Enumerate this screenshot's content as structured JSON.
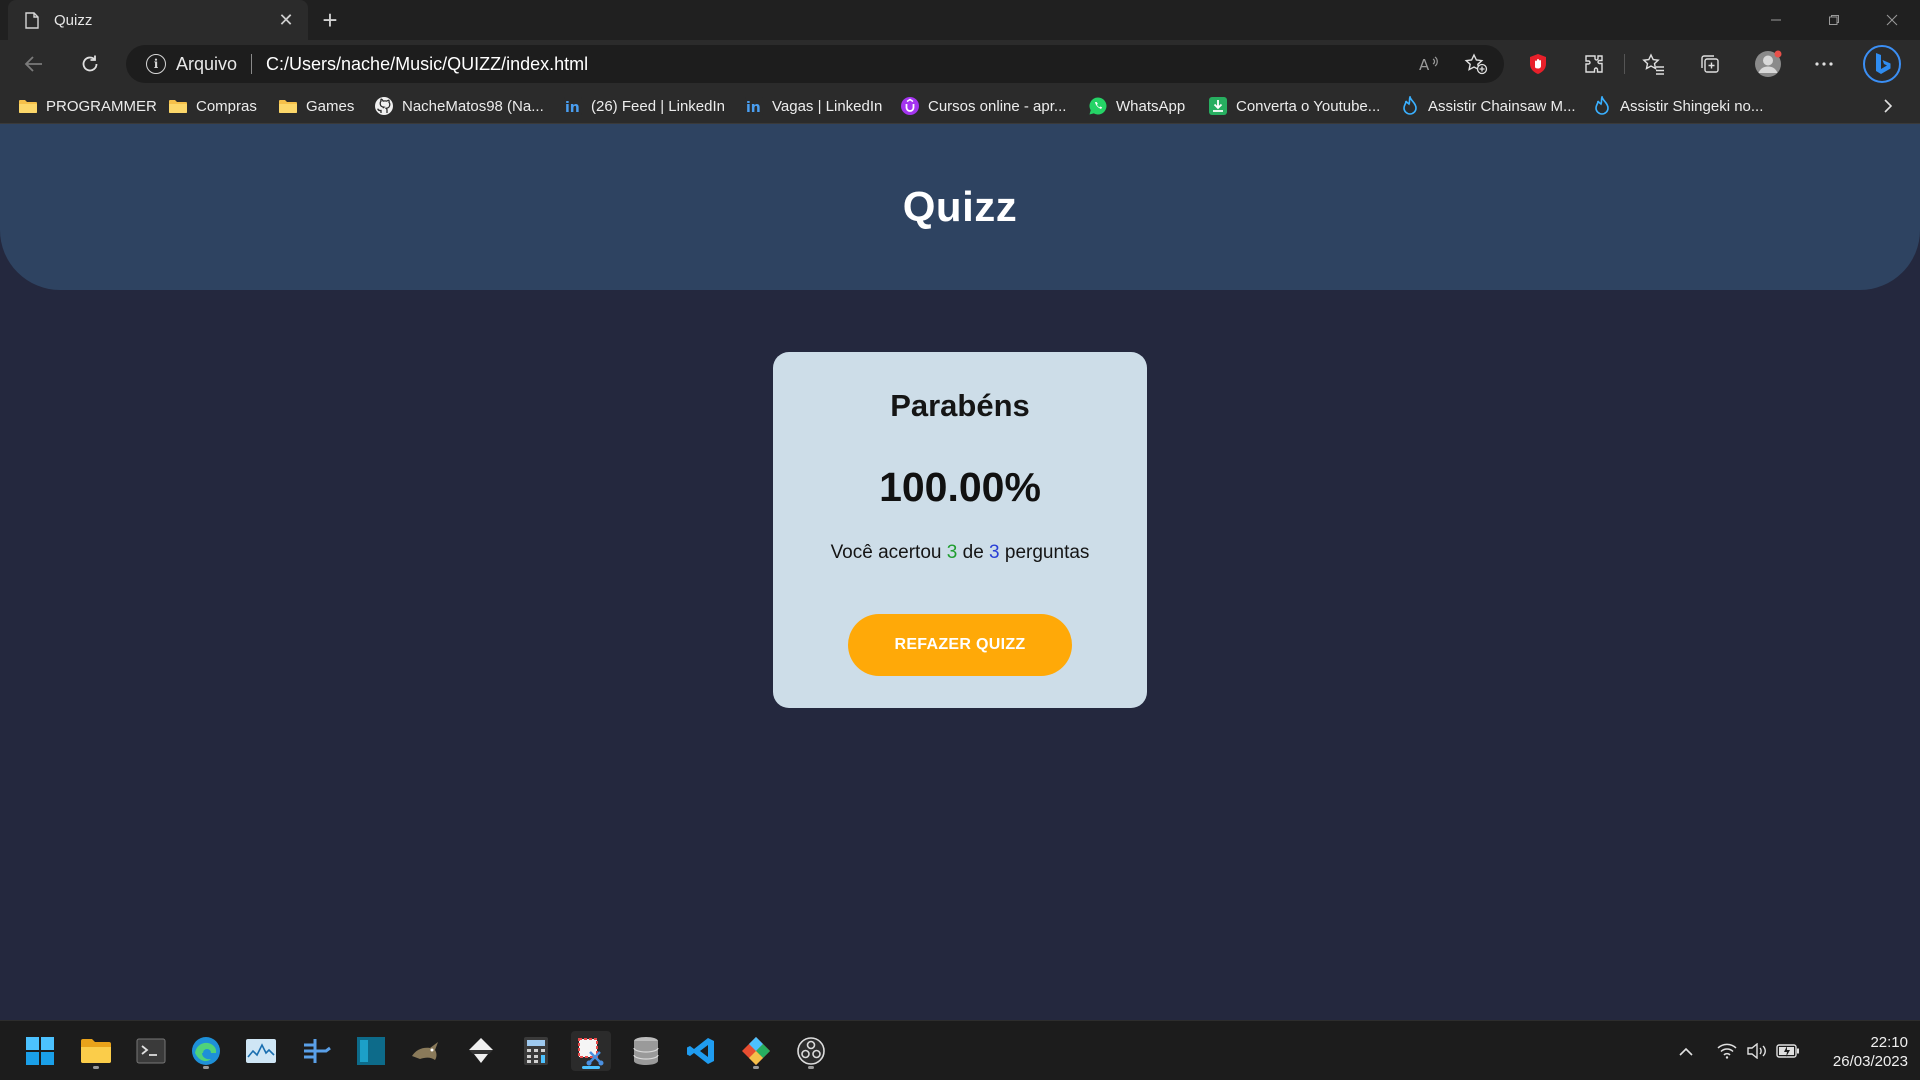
{
  "browser": {
    "tab": {
      "title": "Quizz",
      "close": "✕"
    },
    "new_tab": "+",
    "address": {
      "site_label": "Arquivo",
      "url": "C:/Users/nache/Music/QUIZZ/index.html"
    },
    "bookmarks": [
      {
        "label": "PROGRAMMER",
        "icon": "folder-icon"
      },
      {
        "label": "Compras",
        "icon": "folder-icon"
      },
      {
        "label": "Games",
        "icon": "folder-icon"
      },
      {
        "label": "NacheMatos98 (Na...",
        "icon": "github-icon"
      },
      {
        "label": "(26) Feed | LinkedIn",
        "icon": "linkedin-icon"
      },
      {
        "label": "Vagas | LinkedIn",
        "icon": "linkedin-icon"
      },
      {
        "label": "Cursos online - apr...",
        "icon": "udemy-icon"
      },
      {
        "label": "WhatsApp",
        "icon": "whatsapp-icon"
      },
      {
        "label": "Converta o Youtube...",
        "icon": "download-icon"
      },
      {
        "label": "Assistir Chainsaw M...",
        "icon": "anime-site-icon"
      },
      {
        "label": "Assistir Shingeki no...",
        "icon": "anime-site-icon"
      }
    ]
  },
  "page": {
    "header_title": "Quizz",
    "card": {
      "heading": "Parabéns",
      "score": "100.00%",
      "summary_prefix": "Você acertou ",
      "correct": "3",
      "summary_middle": " de ",
      "total": "3",
      "summary_suffix": " perguntas",
      "restart_label": "REFAZER QUIZZ"
    }
  },
  "taskbar": {
    "time": "22:10",
    "date": "26/03/2023"
  },
  "colors": {
    "page_bg": "#24283e",
    "header_bg": "#2e4361",
    "card_bg": "#cddde8",
    "button_bg": "#ffa908",
    "correct_color": "#1f9d2e",
    "total_color": "#2a3fd6"
  }
}
